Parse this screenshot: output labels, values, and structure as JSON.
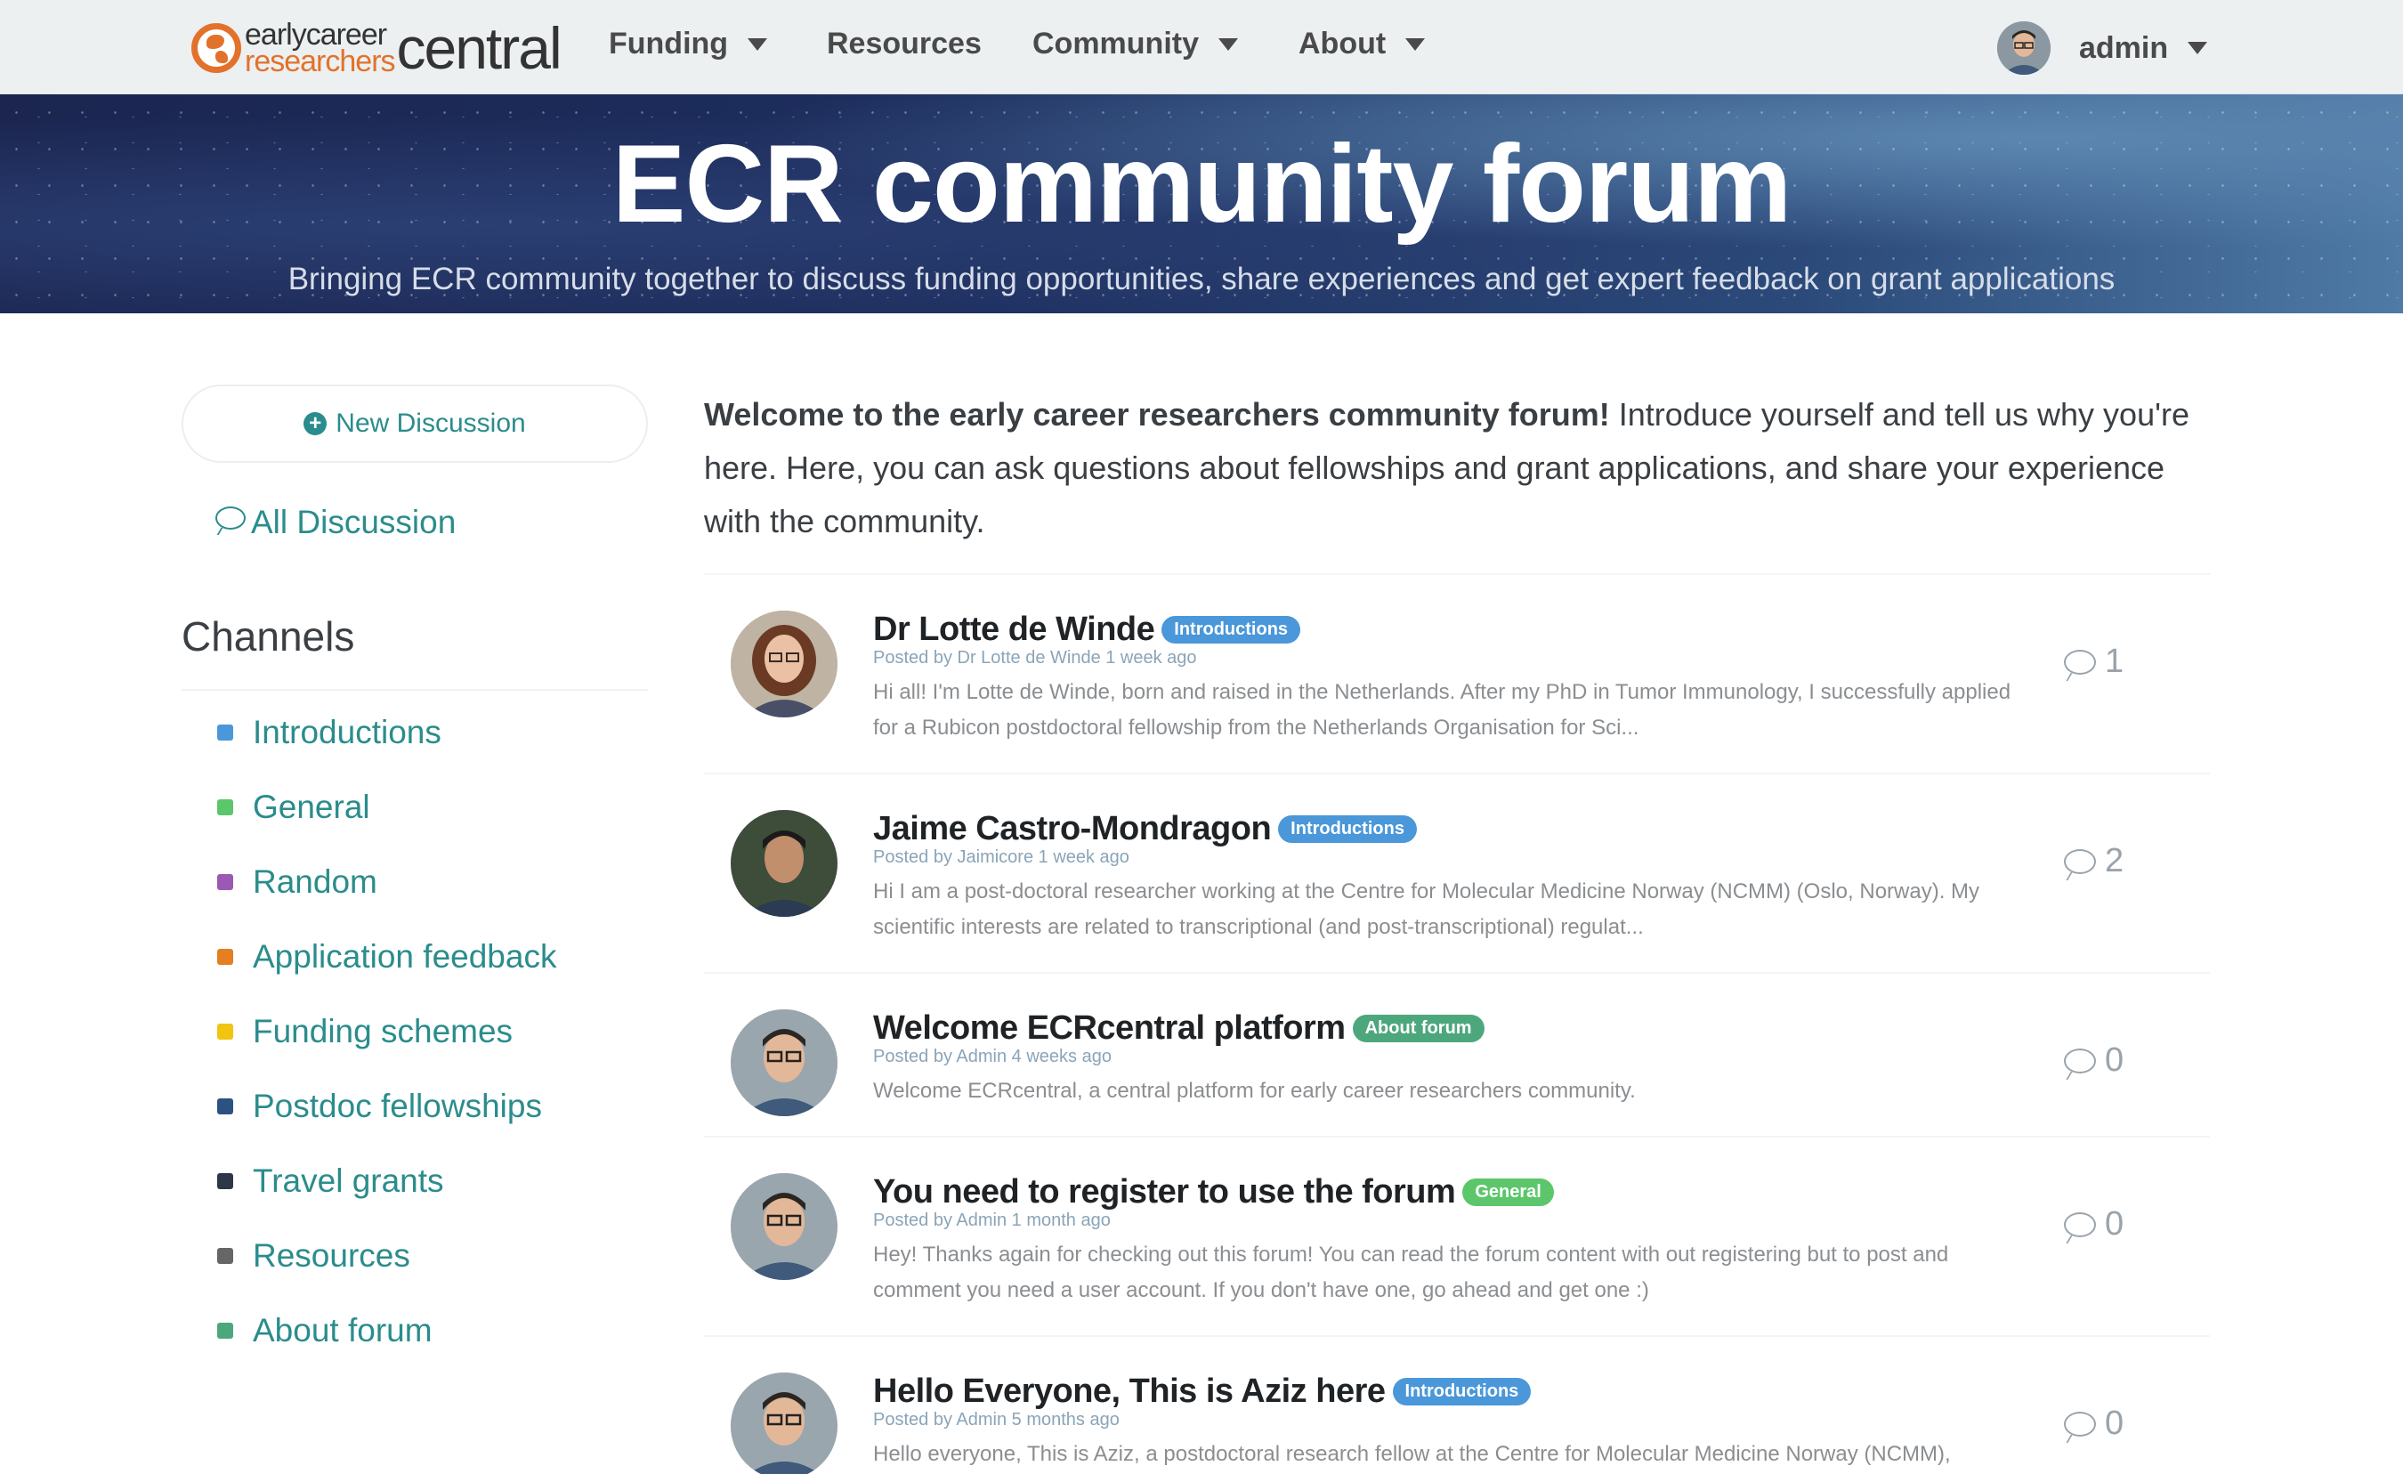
{
  "colors": {
    "brand_orange": "#e2722b",
    "link_teal": "#2b8c8c",
    "nav_bg": "#ecf0f1",
    "tag_introductions": "#4a97d9",
    "tag_about_forum": "#4da77c",
    "tag_general": "#5cc66b"
  },
  "nav": {
    "logo": {
      "early": "earlycareer",
      "researchers": "researchers",
      "central": "central"
    },
    "items": [
      {
        "label": "Funding",
        "has_dropdown": true
      },
      {
        "label": "Resources",
        "has_dropdown": false
      },
      {
        "label": "Community",
        "has_dropdown": true
      },
      {
        "label": "About",
        "has_dropdown": true
      }
    ],
    "user": {
      "name": "admin"
    }
  },
  "hero": {
    "title": "ECR community forum",
    "subtitle": "Bringing ECR community together to discuss funding opportunities, share experiences and get expert feedback on grant applications"
  },
  "sidebar": {
    "new_discussion_label": "New Discussion",
    "all_discussion_label": "All Discussion",
    "channels_title": "Channels",
    "channels": [
      {
        "label": "Introductions",
        "color": "#4a97d9"
      },
      {
        "label": "General",
        "color": "#5cc66b"
      },
      {
        "label": "Random",
        "color": "#9b59b6"
      },
      {
        "label": "Application feedback",
        "color": "#e67e22"
      },
      {
        "label": "Funding schemes",
        "color": "#f1c40f"
      },
      {
        "label": "Postdoc fellowships",
        "color": "#2c5282"
      },
      {
        "label": "Travel grants",
        "color": "#2d3748"
      },
      {
        "label": "Resources",
        "color": "#666666"
      },
      {
        "label": "About forum",
        "color": "#4da77c"
      }
    ]
  },
  "main": {
    "welcome_bold": "Welcome to the early career researchers community forum!",
    "welcome_rest": " Introduce yourself and tell us why you're here. Here, you can ask questions about fellowships and grant applications, and share your experience with the community.",
    "posts": [
      {
        "title": "Dr Lotte de Winde",
        "tag": "Introductions",
        "tag_color": "#4a97d9",
        "meta": "Posted by Dr Lotte de Winde 1 week ago",
        "excerpt": "Hi all! I'm Lotte de Winde, born and raised in the Netherlands. After my PhD in Tumor Immunology, I successfully applied for a Rubicon postdoctoral fellowship from the Netherlands Organisation for Sci...",
        "count": "1",
        "avatar": "woman"
      },
      {
        "title": "Jaime Castro-Mondragon",
        "tag": "Introductions",
        "tag_color": "#4a97d9",
        "meta": "Posted by Jaimicore 1 week ago",
        "excerpt": "Hi I am a post-doctoral researcher working at the Centre for Molecular Medicine Norway (NCMM) (Oslo, Norway). My scientific interests are related to transcriptional (and post-transcriptional) regulat...",
        "count": "2",
        "avatar": "man"
      },
      {
        "title": "Welcome ECRcentral platform",
        "tag": "About forum",
        "tag_color": "#4da77c",
        "meta": "Posted by Admin 4 weeks ago",
        "excerpt": "Welcome ECRcentral, a central platform for early career researchers community.",
        "count": "0",
        "avatar": "admin"
      },
      {
        "title": "You need to register to use the forum",
        "tag": "General",
        "tag_color": "#5cc66b",
        "meta": "Posted by Admin 1 month ago",
        "excerpt": "Hey! Thanks again for checking out this forum! You can read the forum content with out registering but to post and comment you need a user account. If you don't have one, go ahead and get one :)",
        "count": "0",
        "avatar": "admin"
      },
      {
        "title": "Hello Everyone, This is Aziz here",
        "tag": "Introductions",
        "tag_color": "#4a97d9",
        "meta": "Posted by Admin 5 months ago",
        "excerpt": "Hello everyone, This is Aziz, a postdoctoral research fellow at the Centre for Molecular Medicine Norway (NCMM),",
        "count": "0",
        "avatar": "admin"
      }
    ]
  }
}
